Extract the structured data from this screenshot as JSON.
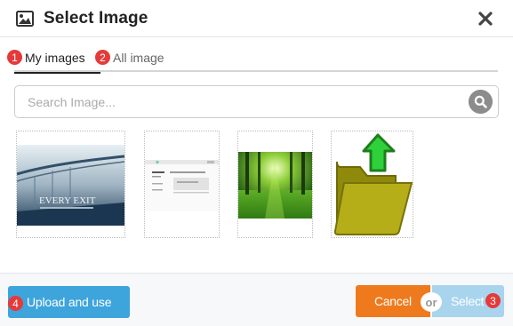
{
  "header": {
    "title": "Select Image",
    "title_icon": "image-icon",
    "close_icon": "close-icon"
  },
  "tabs": [
    {
      "badge": "1",
      "label": "My images",
      "active": true
    },
    {
      "badge": "2",
      "label": "All image",
      "active": false
    }
  ],
  "search": {
    "placeholder": "Search Image...",
    "value": "",
    "icon": "search-icon"
  },
  "images": [
    {
      "caption": "EVERY EXIT",
      "kind": "bridge-poster"
    },
    {
      "kind": "webpage-screenshot"
    },
    {
      "kind": "forest-photo"
    },
    {
      "kind": "upload-folder-icon"
    }
  ],
  "footer": {
    "upload_badge": "4",
    "upload_label": "Upload and use",
    "cancel_label": "Cancel",
    "or_label": "or",
    "select_label": "Select",
    "select_badge": "3"
  },
  "colors": {
    "badge": "#e53a3a",
    "upload": "#3ea4dc",
    "cancel": "#ef7a1d",
    "select": "#a9d4ee"
  }
}
